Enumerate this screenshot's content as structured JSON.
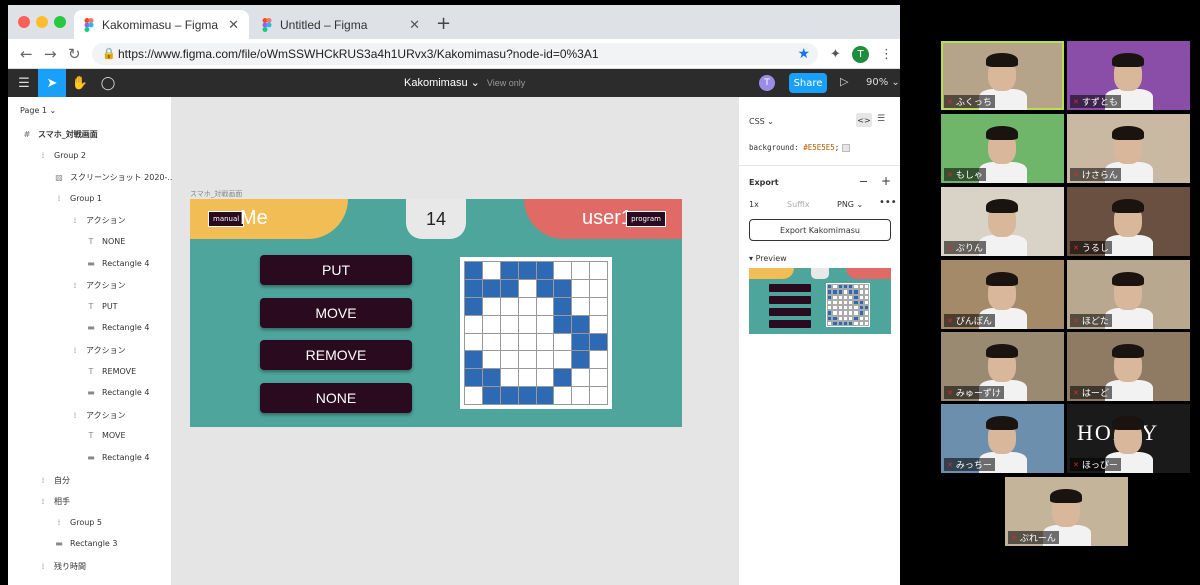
{
  "browser": {
    "tabs": [
      {
        "title": "Kakomimasu – Figma",
        "active": true
      },
      {
        "title": "Untitled – Figma",
        "active": false
      }
    ],
    "url": "https://www.figma.com/file/oWmSSWHCkRUS3a4h1URvx3/Kakomimasu?node-id=0%3A1",
    "profile_initial": "T"
  },
  "figma": {
    "file_title": "Kakomimasu",
    "view_mode": "View only",
    "share_label": "Share",
    "zoom": "90%",
    "user_initial": "T",
    "page": "Page 1",
    "layers": [
      {
        "label": "スマホ_対戦画面",
        "icon": "#",
        "depth": 0,
        "bold": true
      },
      {
        "label": "Group 2",
        "icon": "⁞",
        "depth": 1
      },
      {
        "label": "スクリーンショット 2020-...",
        "icon": "▨",
        "depth": 2
      },
      {
        "label": "Group 1",
        "icon": "⁞",
        "depth": 2
      },
      {
        "label": "アクション",
        "icon": "⁞",
        "depth": 3
      },
      {
        "label": "NONE",
        "icon": "T",
        "depth": 4
      },
      {
        "label": "Rectangle 4",
        "icon": "▬",
        "depth": 4
      },
      {
        "label": "アクション",
        "icon": "⁞",
        "depth": 3
      },
      {
        "label": "PUT",
        "icon": "T",
        "depth": 4
      },
      {
        "label": "Rectangle 4",
        "icon": "▬",
        "depth": 4
      },
      {
        "label": "アクション",
        "icon": "⁞",
        "depth": 3
      },
      {
        "label": "REMOVE",
        "icon": "T",
        "depth": 4
      },
      {
        "label": "Rectangle 4",
        "icon": "▬",
        "depth": 4
      },
      {
        "label": "アクション",
        "icon": "⁞",
        "depth": 3
      },
      {
        "label": "MOVE",
        "icon": "T",
        "depth": 4
      },
      {
        "label": "Rectangle 4",
        "icon": "▬",
        "depth": 4
      },
      {
        "label": "自分",
        "icon": "⁞",
        "depth": 1
      },
      {
        "label": "相手",
        "icon": "⁞",
        "depth": 1
      },
      {
        "label": "Group 5",
        "icon": "⁞",
        "depth": 2
      },
      {
        "label": "Rectangle 3",
        "icon": "▬",
        "depth": 2
      },
      {
        "label": "残り時間",
        "icon": "⁞",
        "depth": 1
      }
    ],
    "frame": {
      "label": "スマホ_対戦画面",
      "me_tag": "manual",
      "me_name": "Me",
      "turn": "14",
      "user_name": "user1",
      "user_tag": "program",
      "actions": [
        "PUT",
        "MOVE",
        "REMOVE",
        "NONE"
      ],
      "board": [
        [
          1,
          0,
          1,
          1,
          1,
          0,
          0,
          0
        ],
        [
          1,
          1,
          1,
          0,
          1,
          1,
          0,
          0
        ],
        [
          1,
          0,
          0,
          0,
          0,
          1,
          0,
          0
        ],
        [
          0,
          0,
          0,
          0,
          0,
          1,
          1,
          0
        ],
        [
          0,
          0,
          0,
          0,
          0,
          0,
          1,
          1
        ],
        [
          1,
          0,
          0,
          0,
          0,
          0,
          1,
          0
        ],
        [
          1,
          1,
          0,
          0,
          0,
          1,
          0,
          0
        ],
        [
          0,
          1,
          1,
          1,
          1,
          0,
          0,
          0
        ]
      ],
      "colors": {
        "background": "#4ea59b",
        "me_bar": "#f2bd55",
        "user_bar": "#e06a66",
        "button": "#2a0a1f",
        "tile": "#2e6ab3"
      }
    },
    "props": {
      "css_label": "CSS",
      "css_property": "background:",
      "css_value": "#E5E5E5",
      "export_title": "Export",
      "export_scale": "1x",
      "export_suffix": "Suffix",
      "export_format": "PNG",
      "export_button": "Export Kakomimasu",
      "preview_label": "Preview"
    }
  },
  "participants": [
    {
      "name": "ふくっち",
      "speaking": true,
      "bg": "#b5a48a"
    },
    {
      "name": "すずとも",
      "bg": "#8a4ea8"
    },
    {
      "name": "もしゃ",
      "bg": "#6fb56a"
    },
    {
      "name": "けさらん",
      "bg": "#c9b9a3"
    },
    {
      "name": "ぷりん",
      "bg": "#d9d2c6"
    },
    {
      "name": "うるし",
      "bg": "#6a5040"
    },
    {
      "name": "ぴんぽん",
      "bg": "#a58a6a"
    },
    {
      "name": "ほどた",
      "bg": "#b8a890"
    },
    {
      "name": "みゅーずけ",
      "bg": "#9a8a72"
    },
    {
      "name": "はーど",
      "bg": "#8f7b63"
    },
    {
      "name": "みっちー",
      "bg": "#6d8fae"
    },
    {
      "name": "ほっぴー",
      "bg": "#1a1a1a",
      "banner": "HOPPY"
    },
    {
      "name": "ぷれーん",
      "bg": "#c4b49a"
    }
  ]
}
